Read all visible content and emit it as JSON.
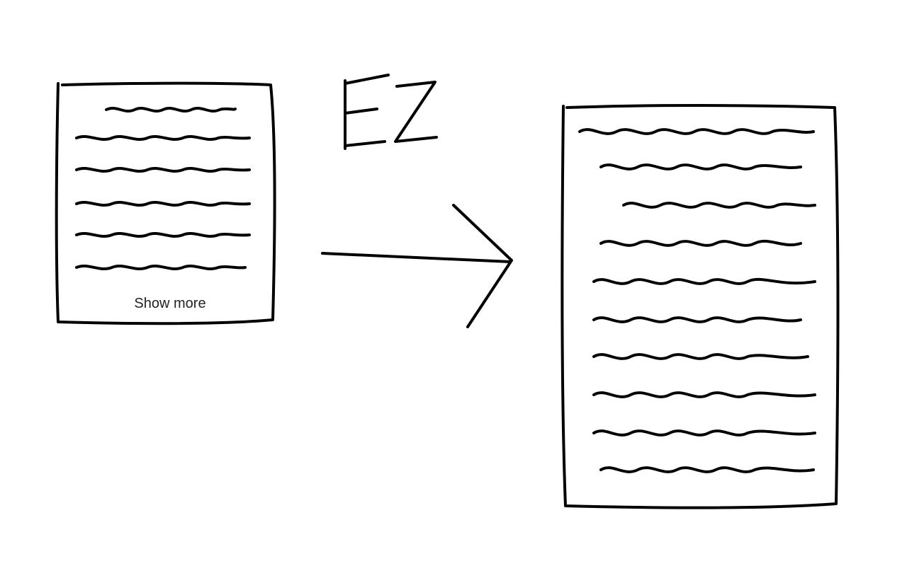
{
  "diagram": {
    "annotation": "EZ",
    "collapsed_card": {
      "show_more_label": "Show more",
      "visible_line_count": 6
    },
    "expanded_card": {
      "visible_line_count": 10
    }
  }
}
